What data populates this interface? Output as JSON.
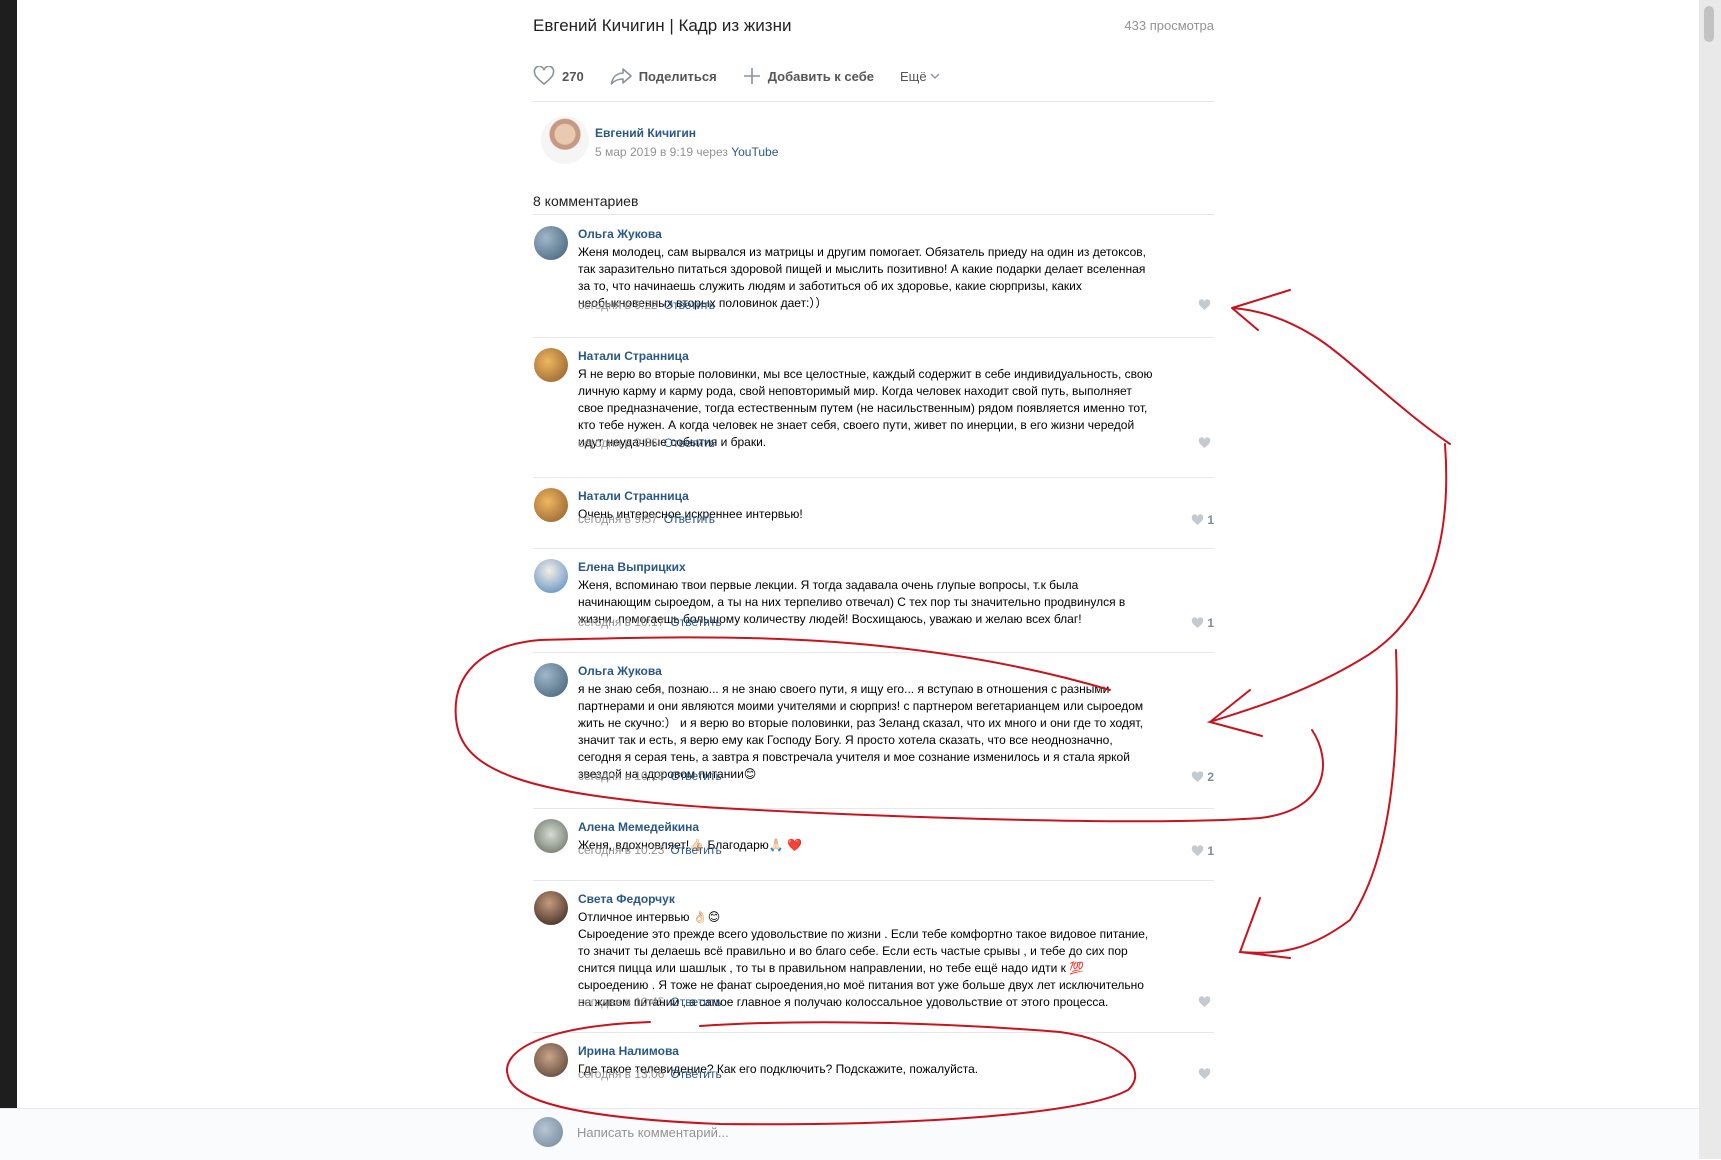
{
  "video": {
    "title": "Евгений Кичигин | Кадр из жизни",
    "views": "433 просмотра"
  },
  "actions": {
    "likes": "270",
    "share": "Поделиться",
    "add": "Добавить к себе",
    "more": "Ещё"
  },
  "author": {
    "name": "Евгений Кичигин",
    "meta": "5 мар 2019 в 9:19 через ",
    "source": "YouTube"
  },
  "comments_count": "8 комментариев",
  "reply_label": "Ответить",
  "comments": [
    {
      "name": "Ольга Жукова",
      "text": "Женя молодец, сам вырвался из матрицы и другим помогает. Обязатель приеду на один из детоксов,\nтак заразительно питаться здоровой пищей и мыслить позитивно! А какие подарки делает вселенная\nза то, что начинаешь служить людям и заботиться об их здоровье, какие сюрпризы, каких\nнеобыкновенных вторых половинок дает:））",
      "time": "сегодня в 9:22",
      "likes": ""
    },
    {
      "name": "Натали Странница",
      "text": "Я не верю во вторые половинки, мы все целостные, каждый содержит в себе индивидуальность, свою\nличную карму и карму рода, свой неповторимый мир. Когда человек находит свой путь, выполняет\nсвое предназначение, тогда естественным путем (не насильственным) рядом появляется именно тот,\nкто тебе нужен. А когда человек не знает себя, своего пути, живет по инерции, в его жизни чередой\nидут неудачные события и браки.",
      "time": "сегодня в 9:56",
      "likes": ""
    },
    {
      "name": "Натали Странница",
      "text": "Очень интересное искреннее интервью!",
      "time": "сегодня в 9:57",
      "likes": "1"
    },
    {
      "name": "Елена Выприцких",
      "text": "Женя, вспоминаю твои первые лекции. Я тогда задавала очень глупые вопросы, т.к была\nначинающим сыроедом, а ты на них терпеливо отвечал) С тех пор ты значительно продвинулся в\nжизни, помогаешь большому количеству людей! Восхищаюсь, уважаю и желаю всех благ!",
      "time": "сегодня в 10:17",
      "likes": "1"
    },
    {
      "name": "Ольга Жукова",
      "text": "я не знаю себя, познаю... я не знаю своего пути, я ищу его... я вступаю в отношения с разными\nпартнерами и они являются моими учителями и сюрприз! с партнером вегетарианцем или сыроедом\nжить не скучно:） и я верю во вторые половинки, раз Зеланд сказал, что их много и они где то ходят,\nзначит так и есть, я верю ему как Господу Богу. Я просто хотела сказать, что все неоднозначно,\nсегодня я серая тень, а завтра я повстречала учителя и мое сознание изменилось и я стала яркой\nзвездой на здоровом питании😊",
      "time": "сегодня в 10:18",
      "likes": "2"
    },
    {
      "name": "Алена Мемедейкина",
      "text": "Женя, вдохновляет!👍🏻 Благодарю🙏🏻 ❤️",
      "time": "сегодня в 10:23",
      "likes": "1"
    },
    {
      "name": "Света Федорчук",
      "text": "Отличное интервью 👌🏻😊\nСыроедение это прежде всего удовольствие по жизни . Если тебе комфортно такое видовое питание,\nто значит ты делаешь всё правильно и во благо себе. Если есть частые срывы , и тебе до сих пор\nснится пицца или шашлык , то ты в правильном направлении, но тебе ещё надо идти к 💯\nсыроедению . Я тоже не фанат сыроедения,но моё питания вот уже больше двух лет исключительно\nна живом питании , а самое главное я получаю колоссальное удовольствие от этого процесса.",
      "time": "сегодня в 10:45",
      "likes": ""
    },
    {
      "name": "Ирина Налимова",
      "text": "Где такое телевидение? Как его подключить? Подскажите, пожалуйста.",
      "time": "сегодня в 13:06",
      "likes": ""
    }
  ],
  "reply_placeholder": "Написать комментарий...",
  "colors": {
    "link": "#2a5885",
    "muted": "#939393",
    "annotation": "#c8141e"
  }
}
